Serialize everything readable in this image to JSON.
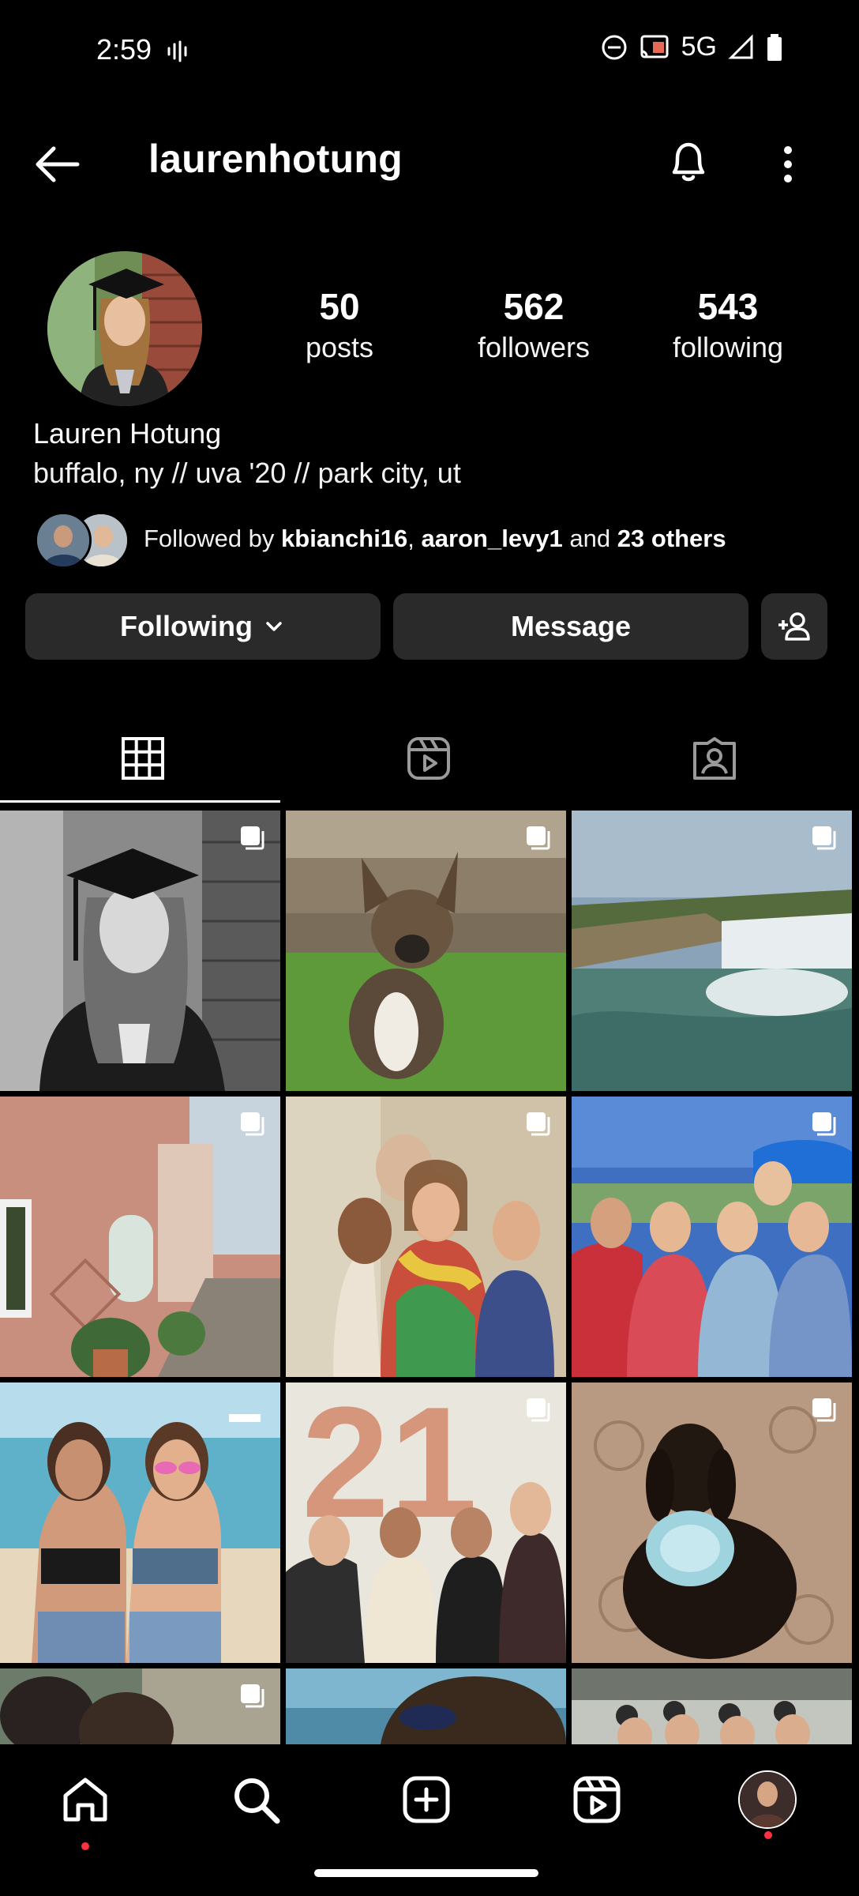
{
  "status_bar": {
    "time": "2:59",
    "network": "5G",
    "icons": [
      "voicemail-icon",
      "dnd-icon",
      "cast-icon",
      "signal-icon",
      "battery-icon"
    ]
  },
  "header": {
    "username": "laurenhotung",
    "icons": [
      "back-arrow-icon",
      "bell-icon",
      "more-vert-icon"
    ]
  },
  "profile": {
    "stats": [
      {
        "value": "50",
        "label": "posts"
      },
      {
        "value": "562",
        "label": "followers"
      },
      {
        "value": "543",
        "label": "following"
      }
    ],
    "name": "Lauren Hotung",
    "bio": "buffalo, ny // uva '20 // park city, ut",
    "followed_by": {
      "prefix": "Followed by",
      "user1": "kbianchi16",
      "sep": ",",
      "user2": "aaron_levy1",
      "and": "and",
      "others": "23 others"
    }
  },
  "actions": {
    "following_label": "Following",
    "message_label": "Message"
  },
  "tabs": [
    "grid-icon",
    "reels-icon",
    "tagged-icon"
  ],
  "grid": {
    "rows": 4,
    "cols": 3
  },
  "bottom_nav": [
    "home-icon",
    "search-icon",
    "create-icon",
    "reels-icon",
    "profile-avatar"
  ],
  "colors": {
    "background": "#000000",
    "button": "#2a2a2a",
    "notification_dot": "#ff3040"
  }
}
